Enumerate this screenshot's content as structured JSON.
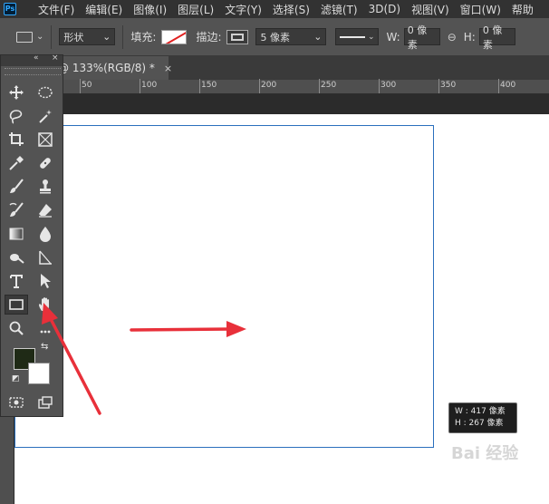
{
  "app": {
    "logo": "Ps"
  },
  "menu": [
    "文件(F)",
    "编辑(E)",
    "图像(I)",
    "图层(L)",
    "文字(Y)",
    "选择(S)",
    "滤镜(T)",
    "3D(D)",
    "视图(V)",
    "窗口(W)",
    "帮助"
  ],
  "options": {
    "mode_value": "形状",
    "fill_label": "填充:",
    "stroke_label": "描边:",
    "stroke_width_value": "5 像素",
    "w_label": "W:",
    "w_value": "0 像素",
    "h_label": "H:",
    "h_value": "0 像素",
    "fill_color": "#ffffff",
    "fill_state": "none (red slash)"
  },
  "document": {
    "tab_title": "@ 133%(RGB/8) *",
    "close_glyph": "×"
  },
  "ruler": {
    "labels": [
      "50",
      "100",
      "150",
      "200",
      "250",
      "300",
      "350",
      "400"
    ]
  },
  "size_tooltip": {
    "w_line": "W : 417 像素",
    "h_line": "H : 267 像素"
  },
  "tools": [
    {
      "name": "move-tool-icon"
    },
    {
      "name": "elliptical-marquee-tool-icon"
    },
    {
      "name": "lasso-tool-icon"
    },
    {
      "name": "magic-wand-tool-icon"
    },
    {
      "name": "crop-tool-icon"
    },
    {
      "name": "frame-tool-icon"
    },
    {
      "name": "eyedropper-tool-icon"
    },
    {
      "name": "healing-brush-tool-icon"
    },
    {
      "name": "brush-tool-icon"
    },
    {
      "name": "clone-stamp-tool-icon"
    },
    {
      "name": "history-brush-tool-icon"
    },
    {
      "name": "eraser-tool-icon"
    },
    {
      "name": "gradient-tool-icon"
    },
    {
      "name": "blur-tool-icon"
    },
    {
      "name": "dodge-tool-icon"
    },
    {
      "name": "pen-tool-icon"
    },
    {
      "name": "type-tool-icon"
    },
    {
      "name": "path-selection-tool-icon"
    },
    {
      "name": "rectangle-tool-icon"
    },
    {
      "name": "hand-tool-icon"
    },
    {
      "name": "zoom-tool-icon"
    },
    {
      "name": "more-tools-icon"
    }
  ],
  "colors": {
    "foreground": "#1f2a16",
    "background": "#ffffff",
    "shape_border": "#2a6fbd",
    "annotation_arrow": "#e8303a"
  },
  "watermark": "Bai 经验"
}
